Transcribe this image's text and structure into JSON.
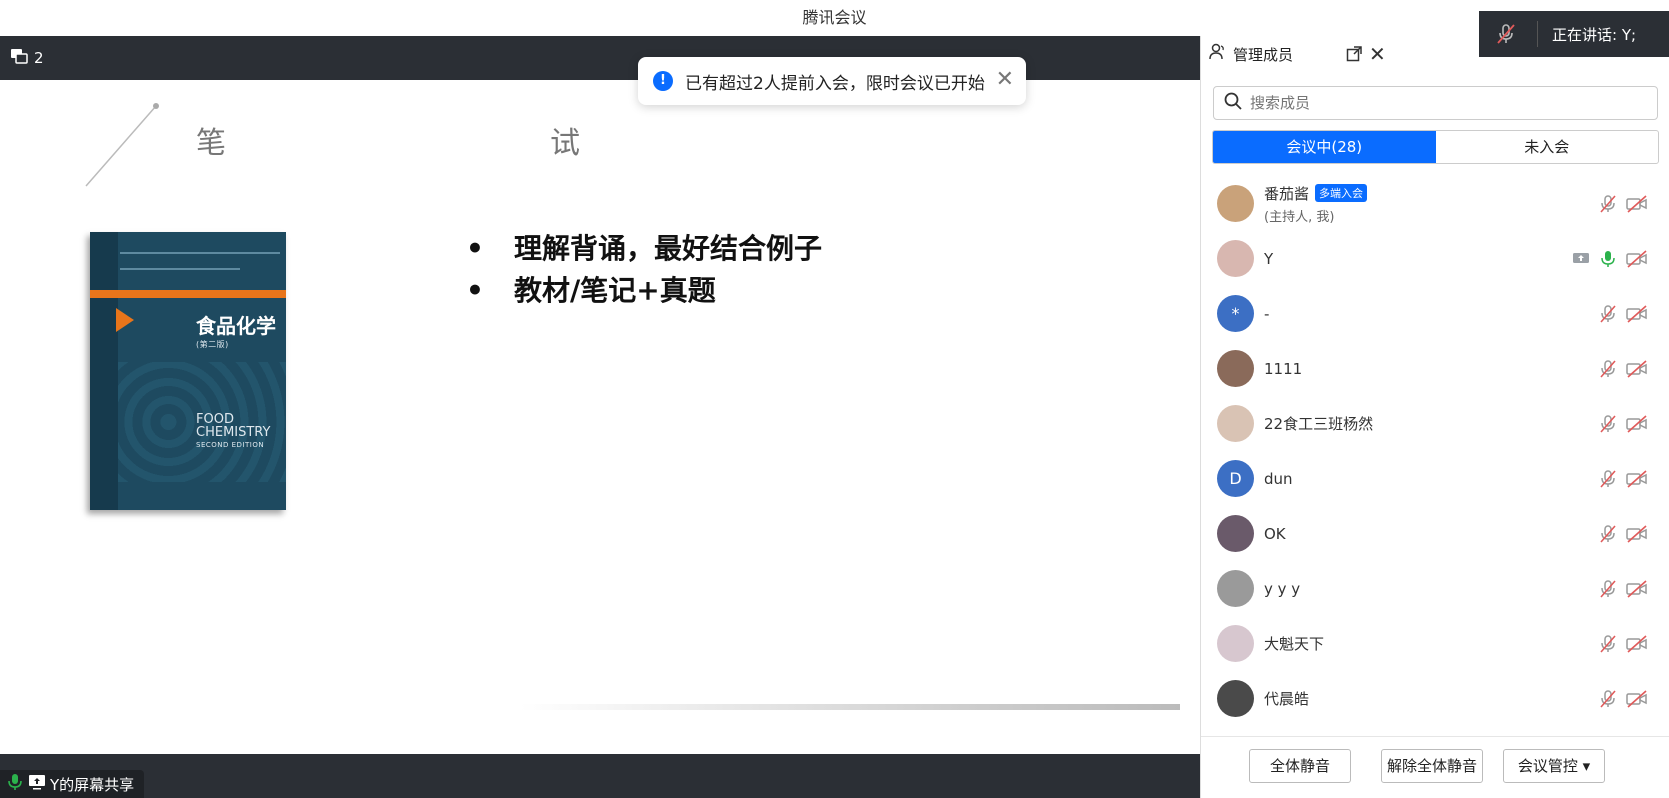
{
  "window": {
    "title": "腾讯会议"
  },
  "speaking": {
    "label": "正在讲话:  Y;"
  },
  "topbar": {
    "participant_count": "2"
  },
  "toast": {
    "message": "已有超过2人提前入会，限时会议已开始",
    "close": "✕"
  },
  "slide": {
    "title_left": "笔",
    "title_right": "试",
    "book_title": "食品化学",
    "book_edition": "(第二版)",
    "book_en": "FOOD CHEMISTRY",
    "book_en_sub": "SECOND EDITION",
    "bullets": [
      "理解背诵，最好结合例子",
      "教材/笔记+真题"
    ],
    "bullet_symbol": "•"
  },
  "share_chip": {
    "label": "Y的屏幕共享"
  },
  "panel": {
    "title": "管理成员",
    "search_placeholder": "搜索成员",
    "tabs": [
      {
        "label": "会议中(28)",
        "active": true
      },
      {
        "label": "未入会",
        "active": false
      }
    ],
    "members": [
      {
        "name": "番茄酱",
        "badge": "多端入会",
        "sub": "(主持人, 我)",
        "avatar_color": "#c9a27a",
        "avatar_text": "",
        "mic": "muted",
        "screen": false
      },
      {
        "name": "Y",
        "badge": "",
        "sub": "",
        "avatar_color": "#d8b7b0",
        "avatar_text": "",
        "mic": "on",
        "screen": true
      },
      {
        "name": "-",
        "badge": "",
        "sub": "",
        "avatar_color": "#3c6fc4",
        "avatar_text": "*",
        "mic": "muted",
        "screen": false
      },
      {
        "name": "1111",
        "badge": "",
        "sub": "",
        "avatar_color": "#8a6a5a",
        "avatar_text": "",
        "mic": "muted",
        "screen": false
      },
      {
        "name": "22食工三班杨然",
        "badge": "",
        "sub": "",
        "avatar_color": "#d9c3b4",
        "avatar_text": "",
        "mic": "muted",
        "screen": false
      },
      {
        "name": "dun",
        "badge": "",
        "sub": "",
        "avatar_color": "#3c6fc4",
        "avatar_text": "D",
        "mic": "muted",
        "screen": false
      },
      {
        "name": "OK",
        "badge": "",
        "sub": "",
        "avatar_color": "#6a5a6a",
        "avatar_text": "",
        "mic": "muted",
        "screen": false
      },
      {
        "name": "y y y",
        "badge": "",
        "sub": "",
        "avatar_color": "#9a9a9a",
        "avatar_text": "",
        "mic": "muted",
        "screen": false
      },
      {
        "name": "大魁天下",
        "badge": "",
        "sub": "",
        "avatar_color": "#d7c7cf",
        "avatar_text": "",
        "mic": "muted",
        "screen": false
      },
      {
        "name": "代晨皓",
        "badge": "",
        "sub": "",
        "avatar_color": "#4a4a4a",
        "avatar_text": "",
        "mic": "muted",
        "screen": false
      }
    ],
    "footer": {
      "mute_all": "全体静音",
      "unmute_all": "解除全体静音",
      "control": "会议管控"
    }
  },
  "colors": {
    "accent": "#0a6cff",
    "mic_on": "#2bb24c",
    "muted": "#e05a5a",
    "dark_bar": "#2b2f35"
  }
}
